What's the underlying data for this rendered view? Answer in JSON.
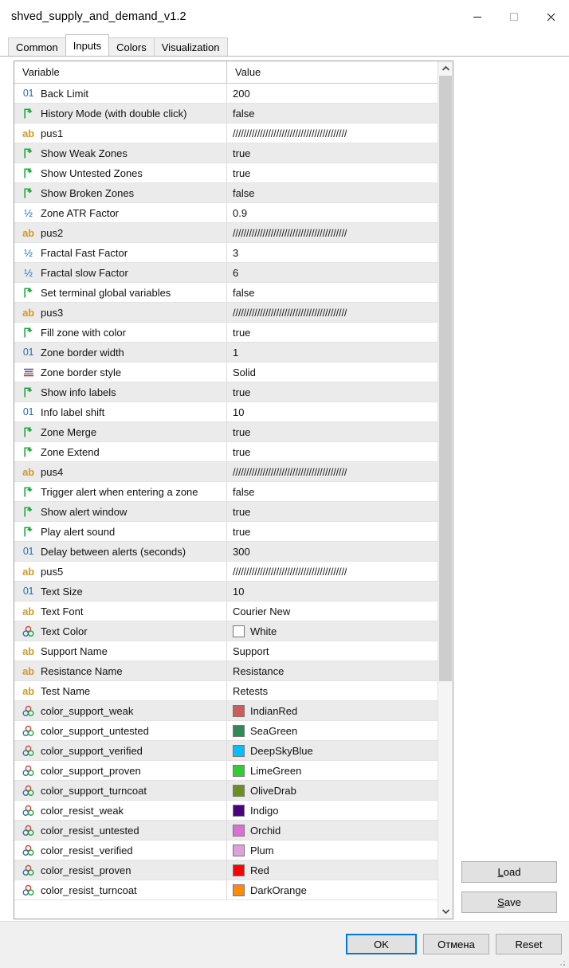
{
  "window": {
    "title": "shved_supply_and_demand_v1.2",
    "buttons": {
      "minimize": "minimize-button",
      "maximize": "maximize-button",
      "close": "close-button"
    }
  },
  "tabs": [
    {
      "label": "Common",
      "active": false
    },
    {
      "label": "Inputs",
      "active": true
    },
    {
      "label": "Colors",
      "active": false
    },
    {
      "label": "Visualization",
      "active": false
    }
  ],
  "grid": {
    "columns": [
      "Variable",
      "Value"
    ],
    "separator_value": "//////////////////////////////////////////",
    "rows": [
      {
        "icon": "int",
        "name": "Back Limit",
        "value": "200"
      },
      {
        "icon": "bool",
        "name": "History Mode (with double click)",
        "value": "false"
      },
      {
        "icon": "str",
        "name": "pus1",
        "value": "//////////////////////////////////////////",
        "sep": true
      },
      {
        "icon": "bool",
        "name": "Show Weak Zones",
        "value": "true"
      },
      {
        "icon": "bool",
        "name": "Show Untested Zones",
        "value": "true"
      },
      {
        "icon": "bool",
        "name": "Show Broken Zones",
        "value": "false"
      },
      {
        "icon": "dbl",
        "name": "Zone ATR Factor",
        "value": "0.9"
      },
      {
        "icon": "str",
        "name": "pus2",
        "value": "//////////////////////////////////////////",
        "sep": true
      },
      {
        "icon": "dbl",
        "name": "Fractal Fast Factor",
        "value": "3"
      },
      {
        "icon": "dbl",
        "name": "Fractal slow Factor",
        "value": "6"
      },
      {
        "icon": "bool",
        "name": "Set terminal global variables",
        "value": "false"
      },
      {
        "icon": "str",
        "name": "pus3",
        "value": "//////////////////////////////////////////",
        "sep": true
      },
      {
        "icon": "bool",
        "name": "Fill zone with color",
        "value": "true"
      },
      {
        "icon": "int",
        "name": "Zone border width",
        "value": "1"
      },
      {
        "icon": "style",
        "name": "Zone border style",
        "value": "Solid"
      },
      {
        "icon": "bool",
        "name": "Show info labels",
        "value": "true"
      },
      {
        "icon": "int",
        "name": "Info label shift",
        "value": "10"
      },
      {
        "icon": "bool",
        "name": "Zone Merge",
        "value": "true"
      },
      {
        "icon": "bool",
        "name": "Zone Extend",
        "value": "true"
      },
      {
        "icon": "str",
        "name": "pus4",
        "value": "//////////////////////////////////////////",
        "sep": true
      },
      {
        "icon": "bool",
        "name": "Trigger alert when entering a zone",
        "value": "false"
      },
      {
        "icon": "bool",
        "name": "Show alert window",
        "value": "true"
      },
      {
        "icon": "bool",
        "name": "Play alert sound",
        "value": "true"
      },
      {
        "icon": "int",
        "name": "Delay between alerts (seconds)",
        "value": "300"
      },
      {
        "icon": "str",
        "name": "pus5",
        "value": "//////////////////////////////////////////",
        "sep": true
      },
      {
        "icon": "int",
        "name": "Text Size",
        "value": "10"
      },
      {
        "icon": "str",
        "name": "Text Font",
        "value": "Courier New"
      },
      {
        "icon": "color",
        "name": "Text Color",
        "value": "White",
        "swatch": "#ffffff"
      },
      {
        "icon": "str",
        "name": "Support Name",
        "value": "Support"
      },
      {
        "icon": "str",
        "name": "Resistance Name",
        "value": "Resistance"
      },
      {
        "icon": "str",
        "name": "Test Name",
        "value": "Retests"
      },
      {
        "icon": "color",
        "name": "color_support_weak",
        "value": "IndianRed",
        "swatch": "#cd5c5c"
      },
      {
        "icon": "color",
        "name": "color_support_untested",
        "value": "SeaGreen",
        "swatch": "#2e8b57"
      },
      {
        "icon": "color",
        "name": "color_support_verified",
        "value": "DeepSkyBlue",
        "swatch": "#00bfff"
      },
      {
        "icon": "color",
        "name": "color_support_proven",
        "value": "LimeGreen",
        "swatch": "#32cd32"
      },
      {
        "icon": "color",
        "name": "color_support_turncoat",
        "value": "OliveDrab",
        "swatch": "#6b8e23"
      },
      {
        "icon": "color",
        "name": "color_resist_weak",
        "value": "Indigo",
        "swatch": "#4b0082"
      },
      {
        "icon": "color",
        "name": "color_resist_untested",
        "value": "Orchid",
        "swatch": "#da70d6"
      },
      {
        "icon": "color",
        "name": "color_resist_verified",
        "value": "Plum",
        "swatch": "#dda0dd"
      },
      {
        "icon": "color",
        "name": "color_resist_proven",
        "value": "Red",
        "swatch": "#ff0000"
      },
      {
        "icon": "color",
        "name": "color_resist_turncoat",
        "value": "DarkOrange",
        "swatch": "#ff8c00"
      }
    ]
  },
  "side_buttons": {
    "load": {
      "pre": "L",
      "post": "oad"
    },
    "save": {
      "pre": "S",
      "post": "ave"
    }
  },
  "footer_buttons": {
    "ok": "OK",
    "cancel": "Отмена",
    "reset": "Reset"
  },
  "colors": {
    "accent": "#0078d7",
    "button_face": "#e1e1e1",
    "row_alt": "#ebebeb",
    "icon_int": "#1f6fb5",
    "icon_string": "#d39a28",
    "icon_bool": "#1ba83c"
  }
}
